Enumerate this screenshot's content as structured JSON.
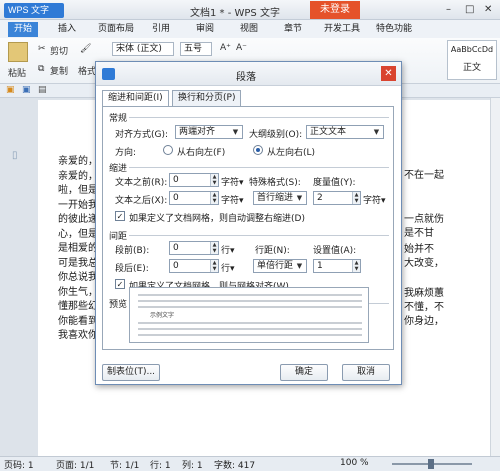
{
  "app": {
    "logo": "WPS 文字",
    "doc_title": "文档1 * - WPS 文字",
    "login_label": "未登录",
    "win_controls": [
      "–",
      "□",
      "✕"
    ]
  },
  "menu_tabs": [
    "开始",
    "插入",
    "页面布局",
    "引用",
    "审阅",
    "视图",
    "章节",
    "开发工具",
    "特色功能"
  ],
  "ribbon": {
    "cut": "剪切",
    "copy": "复制",
    "format_painter": "格式刷",
    "paste": "粘贴",
    "font_name": "宋体 (正文)",
    "font_size": "五号",
    "style_preview": "AaBbCcDd",
    "style_name": "正文"
  },
  "document": {
    "lines": [
      "亲爱的，",
      "亲爱的，",
      "啦，但是",
      "一开始我",
      "的彼此递",
      "心，但是",
      "是相爱的",
      "可是我总",
      "你总说我",
      "你生气，",
      "懂那些幻",
      "你能看到",
      "我喜欢你"
    ],
    "right_fragments": [
      "不在一起",
      "一点就伤",
      "是不甘",
      "始并不",
      "大改变，",
      "我麻烦蕙",
      "不懂，不",
      "你身边，"
    ]
  },
  "dialog": {
    "title": "段落",
    "tabs": [
      "缩进和间距(I)",
      "换行和分页(P)"
    ],
    "general": {
      "section": "常规",
      "align_label": "对齐方式(G):",
      "align_value": "两端对齐",
      "outline_label": "大纲级别(O):",
      "outline_value": "正文文本",
      "direction_label": "方向:",
      "rtl_label": "从右向左(F)",
      "ltr_label": "从左向右(L)",
      "ltr_selected": true
    },
    "indent": {
      "section": "缩进",
      "before_label": "文本之前(R):",
      "before_value": "0",
      "before_unit": "字符▾",
      "special_label": "特殊格式(S):",
      "special_value": "(无)",
      "measure_label": "度量值(Y):",
      "measure_value": "",
      "after_label": "文本之后(X):",
      "after_value": "0",
      "after_unit": "字符▾",
      "special2_value": "首行缩进",
      "measure2_value": "2",
      "measure_unit": "字符▾",
      "auto_adjust_label": "如果定义了文档网格，则自动调整右缩进(D)",
      "auto_adjust_checked": true
    },
    "spacing": {
      "section": "间距",
      "before_label": "段前(B):",
      "before_value": "0",
      "before_unit": "行▾",
      "line_label": "行距(N):",
      "line_value": "",
      "setting_label": "设置值(A):",
      "after_label": "段后(E):",
      "after_value": "0",
      "after_unit": "行▾",
      "line2_value": "单倍行距",
      "setting_value": "1",
      "grid_label": "如果定义了文档网格，则与网格对齐(W)",
      "grid_checked": true
    },
    "preview": {
      "section": "预览",
      "sample_text": "示例文字"
    },
    "tabs_button": "制表位(T)...",
    "ok_button": "确定",
    "cancel_button": "取消"
  },
  "status": {
    "page": "页码: 1",
    "pages": "页面: 1/1",
    "section": "节: 1/1",
    "line": "行: 1",
    "column": "列: 1",
    "words": "字数: 417",
    "zoom": "100 %"
  },
  "colors": {
    "accent": "#3b84d8",
    "login": "#e5522a",
    "close": "#d9442f"
  }
}
